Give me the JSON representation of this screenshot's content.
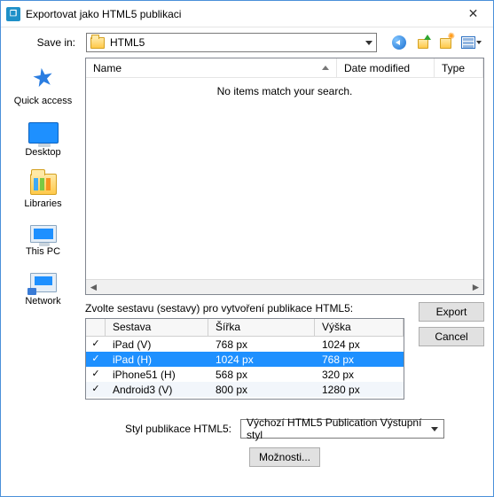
{
  "window": {
    "title": "Exportovat jako HTML5 publikaci",
    "close_glyph": "✕"
  },
  "toolbar": {
    "save_in_label": "Save in:",
    "folder_name": "HTML5"
  },
  "places": {
    "quick_access": "Quick access",
    "desktop": "Desktop",
    "libraries": "Libraries",
    "this_pc": "This PC",
    "network": "Network"
  },
  "filelist": {
    "col_name": "Name",
    "col_date": "Date modified",
    "col_type": "Type",
    "empty_msg": "No items match your search.",
    "scroll_left": "◄",
    "scroll_right": "►"
  },
  "presets": {
    "section_label": "Zvolte sestavu (sestavy) pro vytvoření publikace HTML5:",
    "col_name": "Sestava",
    "col_width": "Šířka",
    "col_height": "Výška",
    "rows": [
      {
        "checked": true,
        "selected": false,
        "name": "iPad (V)",
        "w": "768 px",
        "h": "1024 px"
      },
      {
        "checked": true,
        "selected": true,
        "name": "iPad (H)",
        "w": "1024 px",
        "h": "768 px"
      },
      {
        "checked": true,
        "selected": false,
        "name": "iPhone51 (H)",
        "w": "568 px",
        "h": "320 px"
      },
      {
        "checked": true,
        "selected": false,
        "name": "Android3 (V)",
        "w": "800 px",
        "h": "1280 px"
      }
    ]
  },
  "style": {
    "label": "Styl publikace HTML5:",
    "value": "Výchozí HTML5 Publication Výstupní styl"
  },
  "buttons": {
    "export": "Export",
    "cancel": "Cancel",
    "options": "Možnosti..."
  }
}
